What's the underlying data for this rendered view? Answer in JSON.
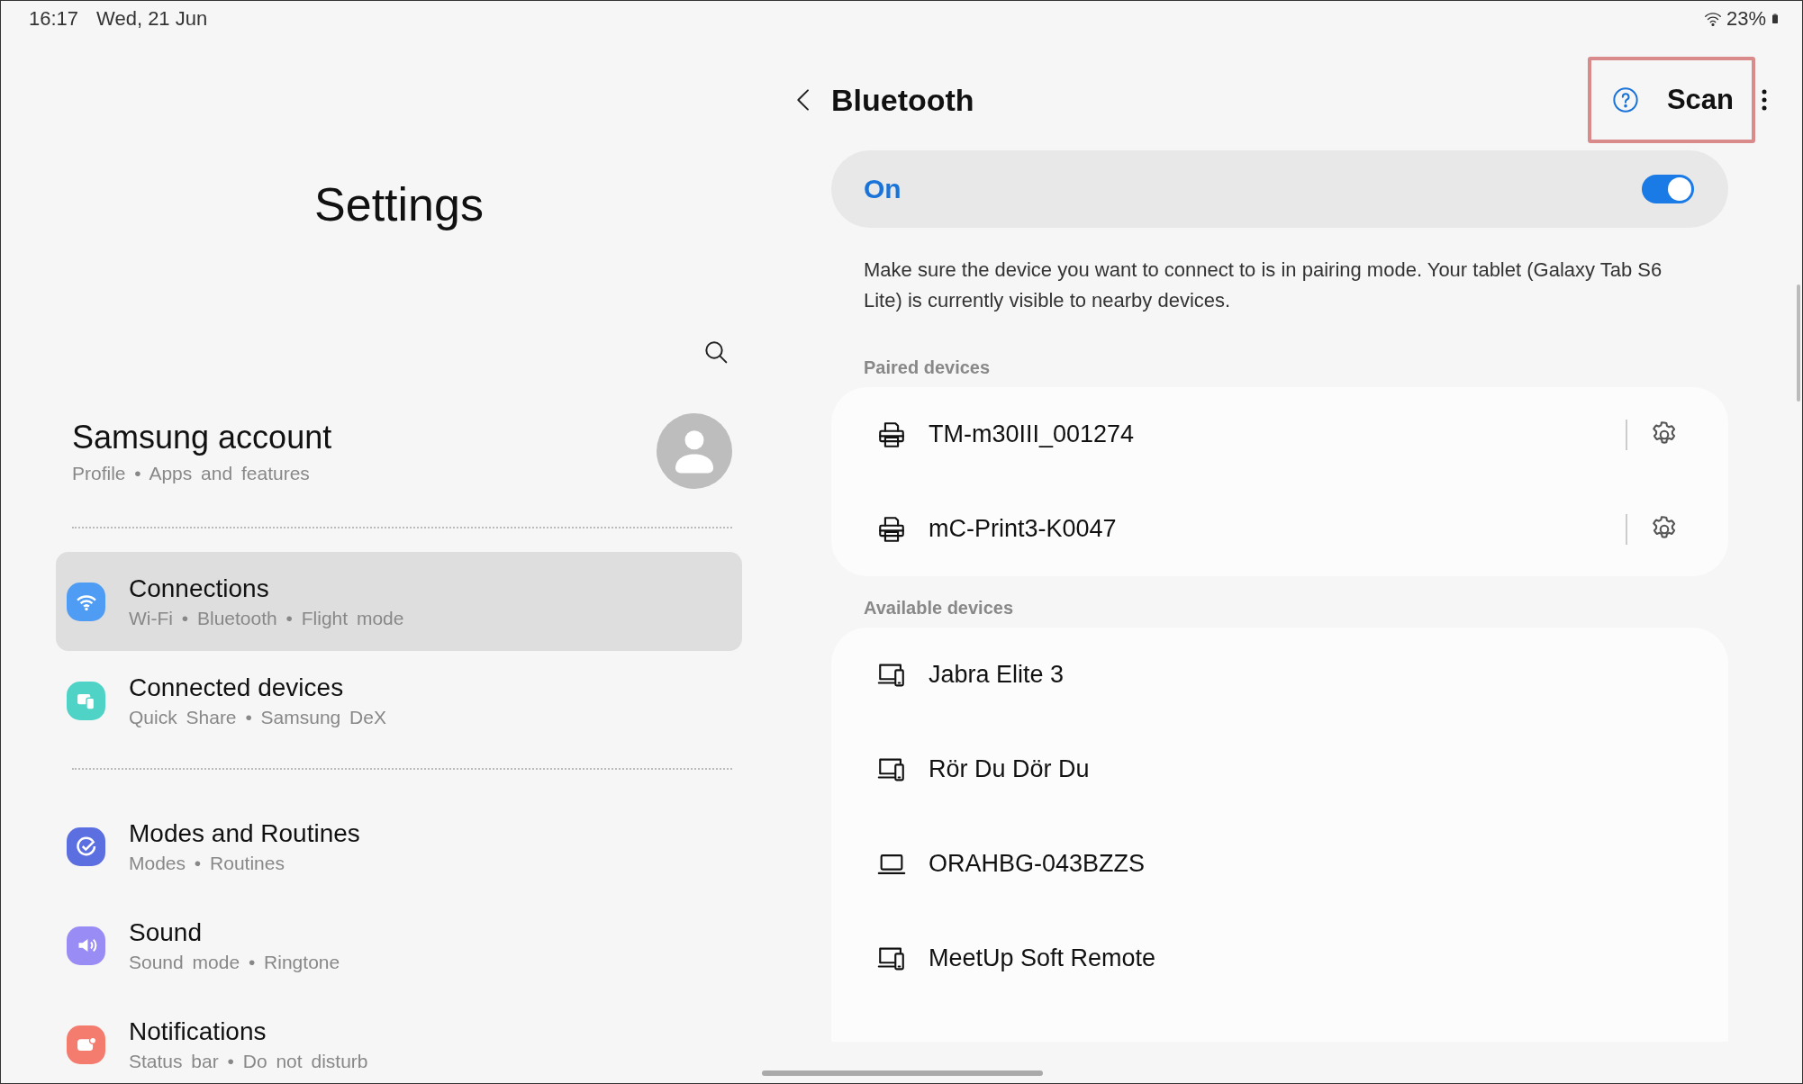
{
  "status_bar": {
    "time": "16:17",
    "date": "Wed, 21 Jun",
    "battery": "23%"
  },
  "settings": {
    "title": "Settings",
    "account": {
      "name": "Samsung account",
      "details": "Profile • Apps and features"
    },
    "groups": [
      [
        {
          "kind": "wifi",
          "color": "#4f9cf5",
          "title": "Connections",
          "details": "Wi-Fi • Bluetooth • Flight mode",
          "selected": true
        },
        {
          "kind": "devices",
          "color": "#4fd3c6",
          "title": "Connected devices",
          "details": "Quick Share • Samsung DeX",
          "selected": false
        }
      ],
      [
        {
          "kind": "modes",
          "color": "#5b6fe0",
          "title": "Modes and Routines",
          "details": "Modes • Routines",
          "selected": false
        },
        {
          "kind": "sound",
          "color": "#9a8cf5",
          "title": "Sound",
          "details": "Sound mode • Ringtone",
          "selected": false
        },
        {
          "kind": "notifications",
          "color": "#f47c6e",
          "title": "Notifications",
          "details": "Status bar • Do not disturb",
          "selected": false
        }
      ]
    ]
  },
  "bluetooth": {
    "title": "Bluetooth",
    "scan": "Scan",
    "scan_highlighted": true,
    "master": {
      "label": "On",
      "on": true
    },
    "description": "Make sure the device you want to connect to is in pairing mode. Your tablet (Galaxy Tab S6 Lite) is currently visible to nearby devices.",
    "sections": [
      {
        "heading": "Paired devices",
        "devices": [
          {
            "kind": "printer",
            "name": "TM-m30III_001274",
            "settings": true
          },
          {
            "kind": "printer",
            "name": "mC-Print3-K0047",
            "settings": true
          }
        ]
      },
      {
        "heading": "Available devices",
        "devices": [
          {
            "kind": "phone-tablet",
            "name": "Jabra Elite 3",
            "settings": false
          },
          {
            "kind": "phone-tablet",
            "name": "Rör Du Dör Du",
            "settings": false
          },
          {
            "kind": "laptop",
            "name": "ORAHBG-043BZZS",
            "settings": false
          },
          {
            "kind": "phone-tablet",
            "name": "MeetUp Soft Remote",
            "settings": false
          }
        ]
      }
    ]
  }
}
